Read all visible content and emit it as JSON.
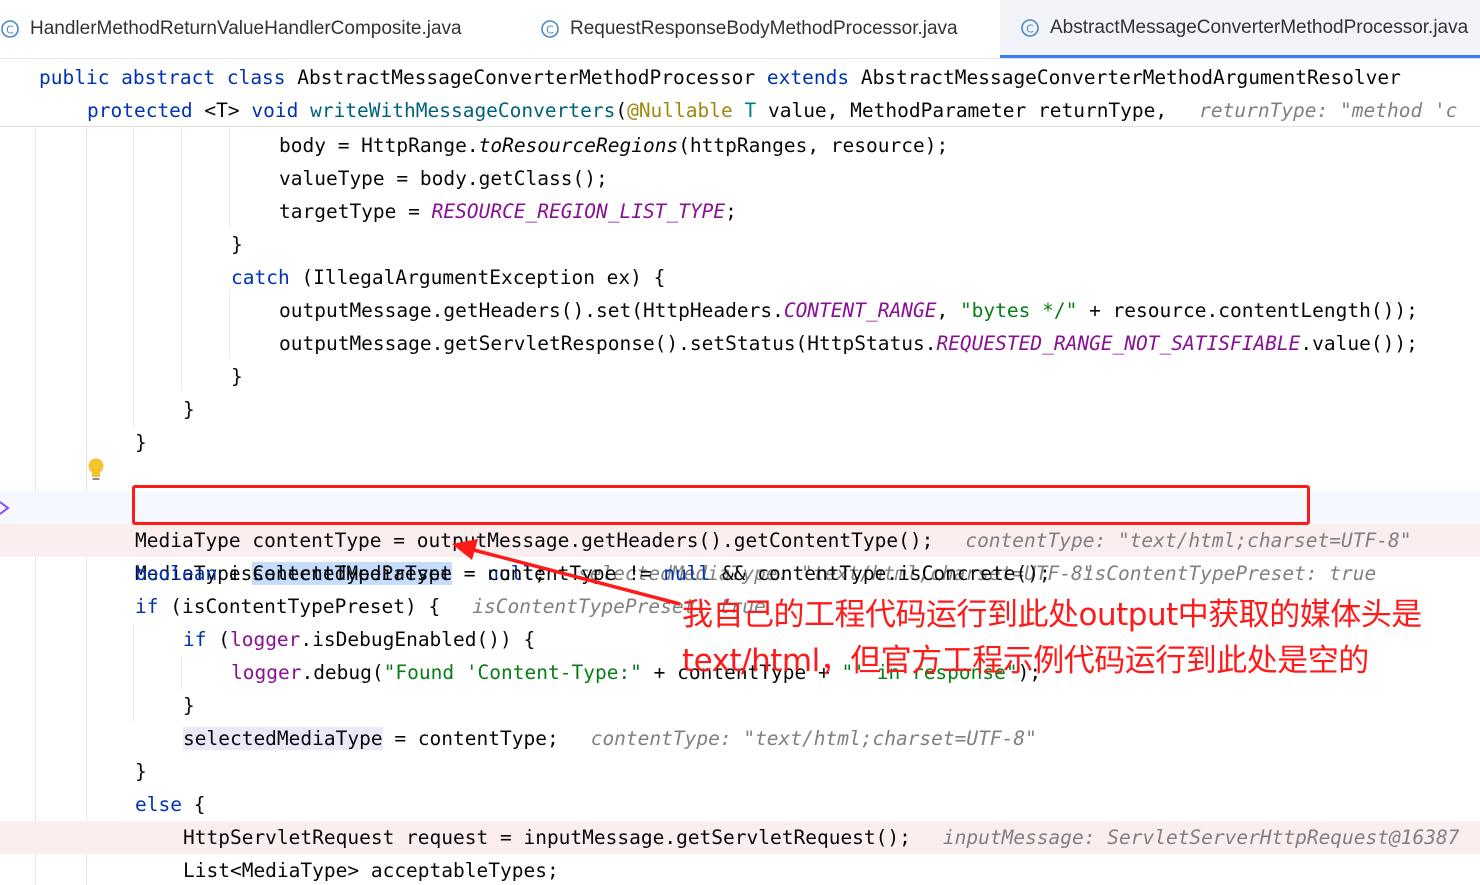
{
  "tabs": [
    {
      "label": "HandlerMethodReturnValueHandlerComposite.java",
      "icon": "class-icon",
      "active": false
    },
    {
      "label": "RequestResponseBodyMethodProcessor.java",
      "icon": "class-icon",
      "active": false
    },
    {
      "label": "AbstractMessageConverterMethodProcessor.java",
      "icon": "class-icon",
      "active": true
    }
  ],
  "sticky": {
    "line1": {
      "kw1": "public abstract class",
      "name": " AbstractMessageConverterMethodProcessor ",
      "kw2": "extends",
      "parent": " AbstractMessageConverterMethodArgumentResolver"
    },
    "line2": {
      "kw": "protected",
      "generic": " <T> ",
      "kw2": "void",
      "method": " writeWithMessageConverters",
      "open": "(",
      "annotation": "@Nullable",
      "tparam": " T",
      "rest": " value, MethodParameter returnType,",
      "hint": "returnType: \"method 'c"
    }
  },
  "code": {
    "l1a": "body = HttpRange.",
    "l1b": "toResourceRegions",
    "l1c": "(httpRanges, resource);",
    "l2": "valueType = body.getClass();",
    "l3a": "targetType = ",
    "l3b": "RESOURCE_REGION_LIST_TYPE",
    "l3c": ";",
    "l4": "}",
    "l5a": "catch",
    "l5b": " (IllegalArgumentException ex) {",
    "l6a": "outputMessage.getHeaders().set(HttpHeaders.",
    "l6b": "CONTENT_RANGE",
    "l6c": ", ",
    "l6d": "\"bytes */\"",
    "l6e": " + resource.contentLength());",
    "l7a": "outputMessage.getServletResponse().setStatus(HttpStatus.",
    "l7b": "REQUESTED_RANGE_NOT_SATISFIABLE",
    "l7c": ".value());",
    "l8": "}",
    "l9": "}",
    "l10": "}",
    "l12a": "MediaType ",
    "l12b": "selectedMediaType",
    "l12c": " = ",
    "l12d": "null",
    "l12e": ";",
    "l12hint": "selectedMediaType: \"text/html;charset=UTF-8\"",
    "l13a": "MediaType contentType = outputMessage.getHeaders().getContentType();",
    "l13hint": "contentType: \"text/html;charset=UTF-8\"",
    "l14a": "boolean",
    "l14b": " isContentTypePreset = contentType != ",
    "l14c": "null",
    "l14d": " && contentType.isConcrete();",
    "l14hint": "isContentTypePreset: true",
    "l15a": "if",
    "l15b": " (isContentTypePreset) {",
    "l15hint": "isContentTypePreset: true",
    "l16a": "if",
    "l16b": " (",
    "l16c": "logger",
    "l16d": ".isDebugEnabled()) {",
    "l17a": "logger",
    "l17b": ".debug(",
    "l17c": "\"Found 'Content-Type:\"",
    "l17d": " + contentType + ",
    "l17e": "\"' in response\"",
    "l17f": ");",
    "l18": "}",
    "l19a": "selectedMediaType",
    "l19b": " = contentType;",
    "l19hint": "contentType: \"text/html;charset=UTF-8\"",
    "l20": "}",
    "l21a": "else",
    "l21b": " {",
    "l22a": "HttpServletRequest request = inputMessage.getServletRequest();",
    "l22hint": "inputMessage: ServletServerHttpRequest@16387",
    "l23": "List<MediaType> acceptableTypes;"
  },
  "annotation_text": {
    "line1": "我自己的工程代码运行到此处output中获取的媒体头是",
    "line2": "text/html，但官方工程示例代码运行到此处是空的"
  },
  "colors": {
    "annotation": "#ff1a1a",
    "keyword": "#0033b3",
    "constant": "#871094",
    "string": "#067d17",
    "hint": "#808080",
    "selection": "#c6dcfc",
    "breakpoint_line": "#fbeeee"
  }
}
